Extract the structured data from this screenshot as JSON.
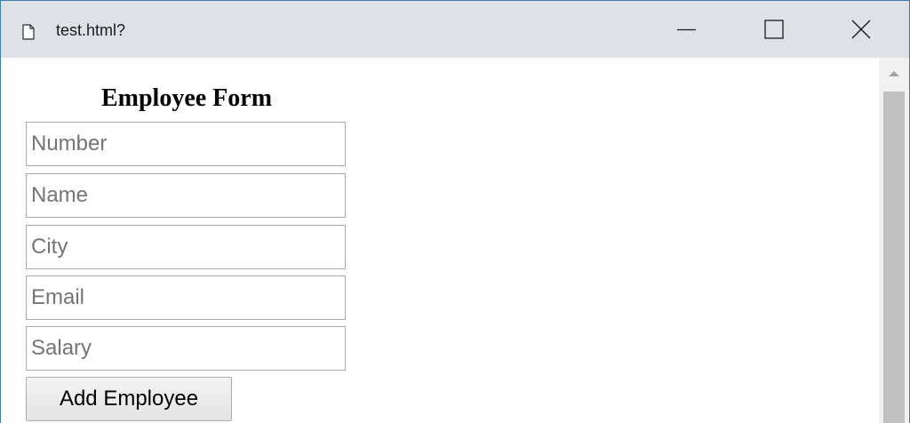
{
  "window": {
    "title": "test.html?"
  },
  "form": {
    "heading": "Employee Form",
    "fields": [
      {
        "placeholder": "Number",
        "value": ""
      },
      {
        "placeholder": "Name",
        "value": ""
      },
      {
        "placeholder": "City",
        "value": ""
      },
      {
        "placeholder": "Email",
        "value": ""
      },
      {
        "placeholder": "Salary",
        "value": ""
      }
    ],
    "submit_label": "Add Employee"
  },
  "icons": {
    "document": "document-icon",
    "minimize": "minimize-icon",
    "maximize": "maximize-icon",
    "close": "close-icon",
    "scroll_up": "scroll-up-arrow-icon"
  },
  "colors": {
    "titlebar_bg": "#dee1e6",
    "window_border": "#3c7fb1",
    "scrollbar_thumb": "#c1c1c1",
    "placeholder_text": "#757575"
  }
}
